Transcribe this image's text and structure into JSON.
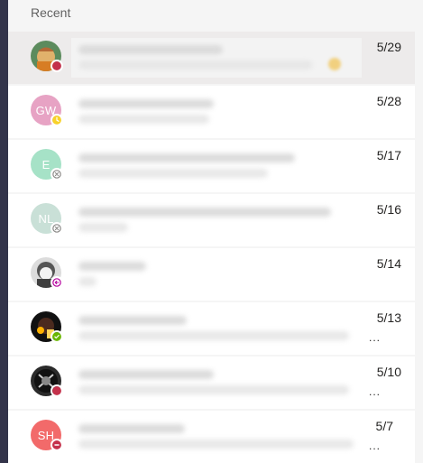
{
  "recent": {
    "title": "Recent",
    "chats": [
      {
        "date": "5/29",
        "avatar_text": "",
        "avatar_kind": "photo",
        "status": "busy",
        "preview_has_emoji": true,
        "preview_ellipsis": ""
      },
      {
        "date": "5/28",
        "avatar_text": "GW",
        "avatar_kind": "initials",
        "avatar_color": "#e7a3c4",
        "status": "away",
        "preview_has_emoji": false,
        "preview_ellipsis": ""
      },
      {
        "date": "5/17",
        "avatar_text": "E",
        "avatar_kind": "initials",
        "avatar_color": "#a6e2c7",
        "status": "offline",
        "preview_has_emoji": false,
        "preview_ellipsis": ""
      },
      {
        "date": "5/16",
        "avatar_text": "NL",
        "avatar_kind": "initials",
        "avatar_color": "#c9e0d7",
        "status": "offline",
        "preview_has_emoji": false,
        "preview_ellipsis": ""
      },
      {
        "date": "5/14",
        "avatar_text": "",
        "avatar_kind": "photo",
        "status": "out-of-office",
        "preview_has_emoji": false,
        "preview_ellipsis": ""
      },
      {
        "date": "5/13",
        "avatar_text": "",
        "avatar_kind": "photo",
        "status": "available",
        "preview_has_emoji": false,
        "preview_ellipsis": "..."
      },
      {
        "date": "5/10",
        "avatar_text": "",
        "avatar_kind": "photo",
        "status": "busy",
        "preview_has_emoji": false,
        "preview_ellipsis": "..."
      },
      {
        "date": "5/7",
        "avatar_text": "SH",
        "avatar_kind": "initials",
        "avatar_color": "#f26a6a",
        "status": "dnd",
        "preview_has_emoji": false,
        "preview_ellipsis": "..."
      }
    ]
  },
  "colors": {
    "available": "#6bb700",
    "busy": "#c4314b",
    "away": "#f8d22a",
    "offline": "#ffffff",
    "out_of_office": "#b4009e",
    "dnd": "#c4314b",
    "rail": "#33344a"
  }
}
